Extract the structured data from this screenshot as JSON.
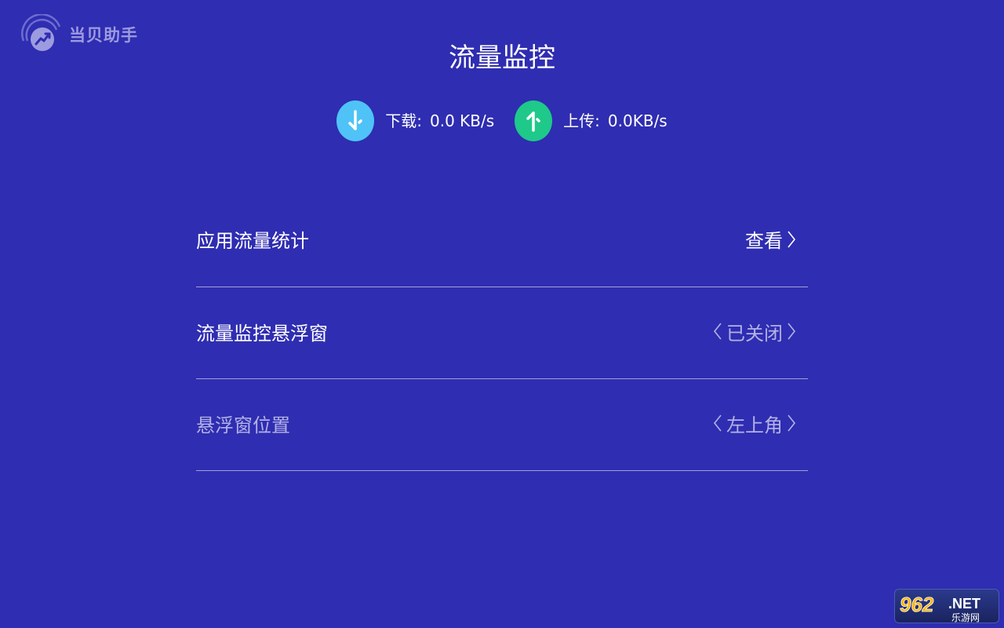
{
  "app": {
    "logo_text": "当贝助手"
  },
  "page": {
    "title": "流量监控"
  },
  "speed": {
    "download": {
      "label": "下载:",
      "value": "0.0 KB/s",
      "icon": "arrow-down-icon",
      "color": "#4fc3f7"
    },
    "upload": {
      "label": "上传:",
      "value": "0.0KB/s",
      "icon": "arrow-up-icon",
      "color": "#1ec98a"
    }
  },
  "settings": {
    "items": [
      {
        "label": "应用流量统计",
        "value": "查看"
      },
      {
        "label": "流量监控悬浮窗",
        "value": "已关闭"
      },
      {
        "label": "悬浮窗位置",
        "value": "左上角"
      }
    ]
  },
  "watermark": {
    "number": "962",
    "suffix": ".NET",
    "caption": "乐游网"
  },
  "colors": {
    "background": "#2f2db1",
    "divider": "#9f9edc",
    "dim_text": "#b3b2e6"
  }
}
